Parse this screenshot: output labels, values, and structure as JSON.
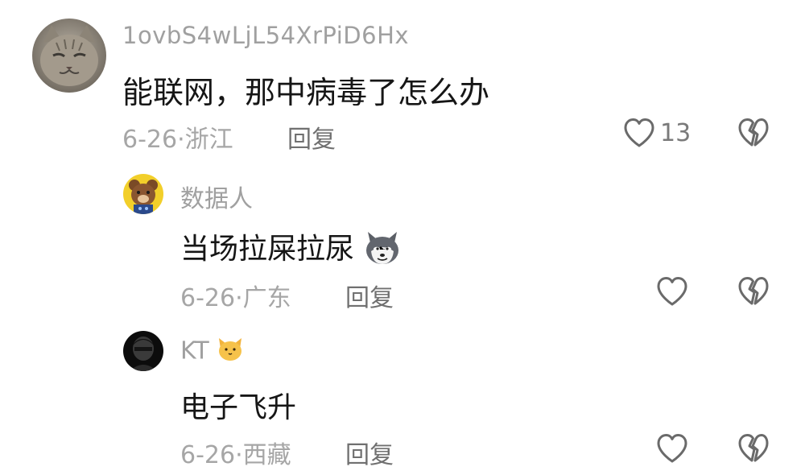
{
  "comments": [
    {
      "username": "1ovbS4wLjL54XrPiD6Hx",
      "text": "能联网，那中病毒了怎么办",
      "date": "6-26·",
      "location": "浙江",
      "reply_label": "回复",
      "like_count": "13",
      "avatar_icon": "cat-avatar",
      "like_icon": "heart-icon",
      "dislike_icon": "broken-heart-icon"
    },
    {
      "username": "数据人",
      "text": "当场拉屎拉尿",
      "text_emoji": "husky-emoji",
      "date": "6-26·",
      "location": "广东",
      "reply_label": "回复",
      "like_count": "",
      "avatar_icon": "cartoon-bear-avatar",
      "like_icon": "heart-icon",
      "dislike_icon": "broken-heart-icon"
    },
    {
      "username": "KT",
      "username_emoji": "cat-face-emoji",
      "text": "电子飞升",
      "date": "6-26·",
      "location": "西藏",
      "reply_label": "回复",
      "like_count": "",
      "avatar_icon": "dark-portrait-avatar",
      "like_icon": "heart-icon",
      "dislike_icon": "broken-heart-icon"
    }
  ],
  "colors": {
    "username": "#a0a0a0",
    "text": "#161616",
    "meta": "#a6a6a6",
    "reply": "#707070",
    "icon": "#6a6a6a"
  }
}
